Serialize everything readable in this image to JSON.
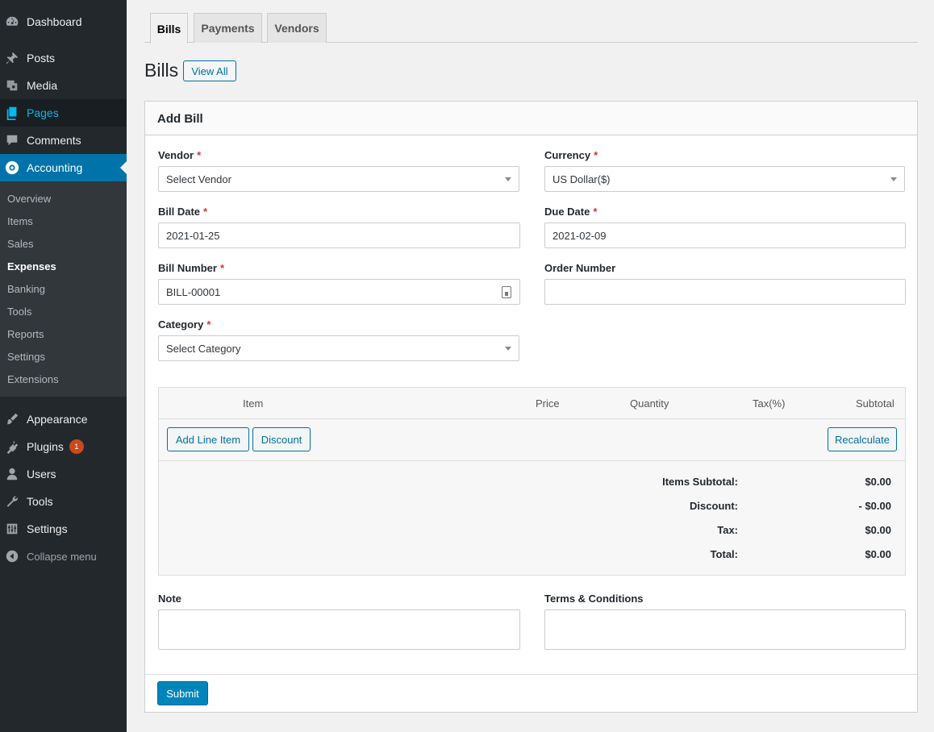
{
  "sidebar": {
    "dashboard": "Dashboard",
    "posts": "Posts",
    "media": "Media",
    "pages": "Pages",
    "comments": "Comments",
    "accounting": "Accounting",
    "submenu": [
      "Overview",
      "Items",
      "Sales",
      "Expenses",
      "Banking",
      "Tools",
      "Reports",
      "Settings",
      "Extensions"
    ],
    "appearance": "Appearance",
    "plugins": "Plugins",
    "plugins_badge": "1",
    "users": "Users",
    "tools": "Tools",
    "settings": "Settings",
    "collapse": "Collapse menu"
  },
  "tabs": [
    "Bills",
    "Payments",
    "Vendors"
  ],
  "heading": {
    "title": "Bills",
    "view_all": "View All"
  },
  "form": {
    "title": "Add Bill",
    "vendor_label": "Vendor",
    "vendor_value": "Select Vendor",
    "currency_label": "Currency",
    "currency_value": "US Dollar($)",
    "bill_date_label": "Bill Date",
    "bill_date_value": "2021-01-25",
    "due_date_label": "Due Date",
    "due_date_value": "2021-02-09",
    "bill_number_label": "Bill Number",
    "bill_number_value": "BILL-00001",
    "order_number_label": "Order Number",
    "order_number_value": "",
    "category_label": "Category",
    "category_value": "Select Category",
    "required_mark": "*"
  },
  "line_items": {
    "columns": [
      "Item",
      "Price",
      "Quantity",
      "Tax(%)",
      "Subtotal"
    ],
    "add_line_item": "Add Line Item",
    "discount": "Discount",
    "recalculate": "Recalculate",
    "totals": [
      {
        "label": "Items Subtotal:",
        "value": "$0.00"
      },
      {
        "label": "Discount:",
        "value": "- $0.00"
      },
      {
        "label": "Tax:",
        "value": "$0.00"
      },
      {
        "label": "Total:",
        "value": "$0.00"
      }
    ]
  },
  "note_label": "Note",
  "terms_label": "Terms & Conditions",
  "submit": "Submit",
  "colors": {
    "sidebar_bg": "#23282d",
    "accent": "#0073aa",
    "pages_link": "#00b9eb",
    "badge": "#ca4a1f",
    "required": "#dc3232"
  }
}
